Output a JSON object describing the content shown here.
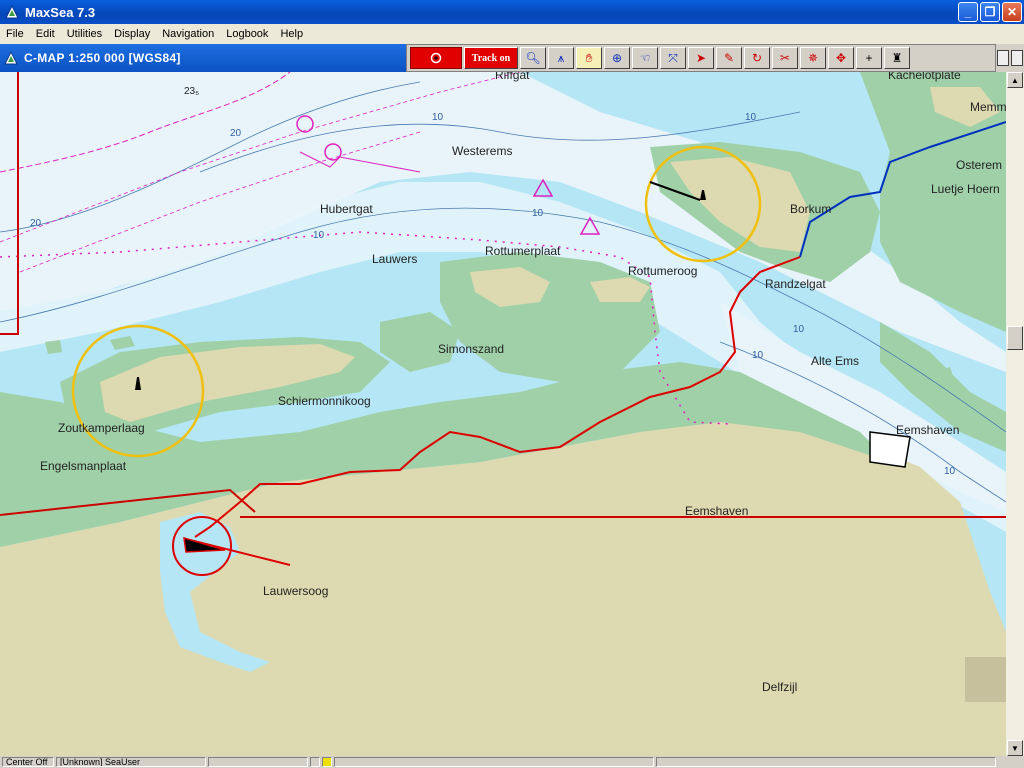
{
  "window": {
    "title": "MaxSea 7.3"
  },
  "menu": [
    "File",
    "Edit",
    "Utilities",
    "Display",
    "Navigation",
    "Logbook",
    "Help"
  ],
  "chart": {
    "title": "C-MAP  1:250 000 [WGS84]"
  },
  "toolbar": {
    "track_label": "Track on"
  },
  "places": [
    {
      "name": "Riffgat"
    },
    {
      "name": "Kachelotplate"
    },
    {
      "name": "Memm"
    },
    {
      "name": "Westerems"
    },
    {
      "name": "Osterem"
    },
    {
      "name": "Luetje Hoern"
    },
    {
      "name": "Hubertgat"
    },
    {
      "name": "Borkum"
    },
    {
      "name": "Rottumerplaat"
    },
    {
      "name": "Lauwers"
    },
    {
      "name": "Rottumeroog"
    },
    {
      "name": "Randzelgat"
    },
    {
      "name": "Simonszand"
    },
    {
      "name": "Alte Ems"
    },
    {
      "name": "Schiermonnikoog"
    },
    {
      "name": "Zoutkamperlaag"
    },
    {
      "name": "Eemshaven"
    },
    {
      "name": "Engelsmanplaat"
    },
    {
      "name": "Eemshaven"
    },
    {
      "name": "Lauwersoog"
    },
    {
      "name": "Delfzijl"
    }
  ],
  "depths": [
    "10",
    "10",
    "10",
    "10",
    "10",
    "10",
    "10",
    "20",
    "20",
    "23₅"
  ],
  "status": {
    "cell1": "Center Off",
    "cell2": "[Unknown] SeaUser"
  },
  "colors": {
    "water_deep": "#b5e6f5",
    "water_shallow": "#e8f4fa",
    "land": "#ddd9b0",
    "tidal_flat": "#9fd0a8",
    "track": "#dd0000",
    "route": "#e020c0",
    "circle": "#f0c010"
  }
}
